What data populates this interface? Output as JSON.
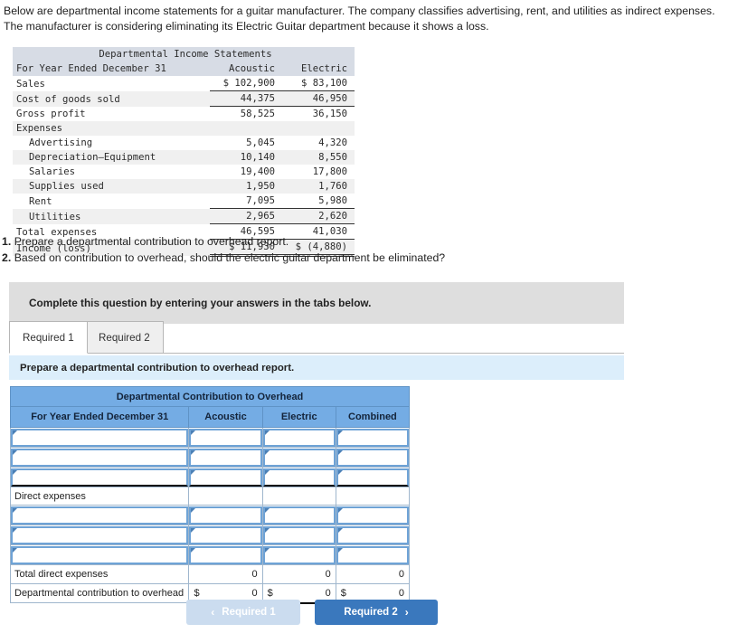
{
  "intro": {
    "paragraph": "Below are departmental income statements for a guitar manufacturer. The company classifies advertising, rent, and utilities as indirect expenses. The manufacturer is considering eliminating its Electric Guitar department because it shows a loss."
  },
  "income_statement": {
    "title": "Departmental Income Statements",
    "period_label": "For Year Ended December 31",
    "col_acoustic": "Acoustic",
    "col_electric": "Electric",
    "rows": [
      {
        "label": "Sales",
        "acoustic": "$ 102,900",
        "electric": "$ 83,100"
      },
      {
        "label": "Cost of goods sold",
        "acoustic": "44,375",
        "electric": "46,950"
      },
      {
        "label": "Gross profit",
        "acoustic": "58,525",
        "electric": "36,150"
      },
      {
        "label": "Expenses",
        "acoustic": "",
        "electric": ""
      },
      {
        "label": "Advertising",
        "acoustic": "5,045",
        "electric": "4,320"
      },
      {
        "label": "Depreciation—Equipment",
        "acoustic": "10,140",
        "electric": "8,550"
      },
      {
        "label": "Salaries",
        "acoustic": "19,400",
        "electric": "17,800"
      },
      {
        "label": "Supplies used",
        "acoustic": "1,950",
        "electric": "1,760"
      },
      {
        "label": "Rent",
        "acoustic": "7,095",
        "electric": "5,980"
      },
      {
        "label": "Utilities",
        "acoustic": "2,965",
        "electric": "2,620"
      },
      {
        "label": "Total expenses",
        "acoustic": "46,595",
        "electric": "41,030"
      },
      {
        "label": "Income (loss)",
        "acoustic": "$ 11,930",
        "electric": "$ (4,880)"
      }
    ]
  },
  "requirements": {
    "num1": "1.",
    "text1": "Prepare a departmental contribution to overhead report.",
    "num2": "2.",
    "text2": "Based on contribution to overhead, should the electric guitar department be eliminated?"
  },
  "banner": {
    "text": "Complete this question by entering your answers in the tabs below."
  },
  "tabs": {
    "tab1_label": "Required 1",
    "tab2_label": "Required 2"
  },
  "sub_instruction": {
    "text": "Prepare a departmental contribution to overhead report."
  },
  "answer_table": {
    "title": "Departmental Contribution to Overhead",
    "headers": {
      "period": "For Year Ended December 31",
      "acoustic": "Acoustic",
      "electric": "Electric",
      "combined": "Combined"
    },
    "direct_expenses_label": "Direct expenses",
    "total_direct_label": "Total direct expenses",
    "contribution_label": "Departmental contribution to overhead",
    "total_direct_values": {
      "acoustic": "0",
      "electric": "0",
      "combined": "0"
    },
    "contribution_values": {
      "acoustic": "0",
      "electric": "0",
      "combined": "0"
    },
    "dollar_sign": "$",
    "input_placeholder": ""
  },
  "nav": {
    "prev_label": "Required 1",
    "prev_chevron": "‹",
    "next_label": "Required 2",
    "next_chevron": "›"
  },
  "colors": {
    "table_header_blue": "#74ace4",
    "active_button_blue": "#3a78bd",
    "disabled_button_blue": "#cbdcef",
    "sub_instruction_blue": "#dceefb",
    "banner_grey": "#dedede",
    "report_band_grey": "#d7dce5"
  }
}
